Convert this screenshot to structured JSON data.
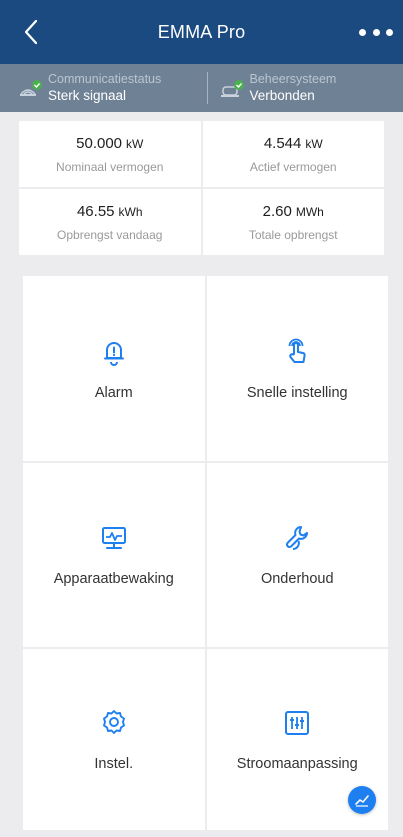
{
  "header": {
    "title": "EMMA Pro",
    "back_icon": "chevron-left-icon",
    "more_icon": "more-horizontal-icon"
  },
  "status": [
    {
      "label": "Communicatiestatus",
      "value": "Sterk signaal",
      "icon": "signal-check-icon"
    },
    {
      "label": "Beheersysteem",
      "value": "Verbonden",
      "icon": "cloud-check-icon"
    }
  ],
  "stats": [
    {
      "value": "50.000",
      "unit": "kW",
      "label": "Nominaal vermogen"
    },
    {
      "value": "4.544",
      "unit": "kW",
      "label": "Actief vermogen"
    },
    {
      "value": "46.55",
      "unit": "kWh",
      "label": "Opbrengst vandaag"
    },
    {
      "value": "2.60",
      "unit": "MWh",
      "label": "Totale opbrengst"
    }
  ],
  "menu": [
    {
      "label": "Alarm",
      "icon": "bell-alert-icon"
    },
    {
      "label": "Snelle instelling",
      "icon": "tap-hand-icon"
    },
    {
      "label": "Apparaatbewaking",
      "icon": "monitor-pulse-icon"
    },
    {
      "label": "Onderhoud",
      "icon": "wrench-icon"
    },
    {
      "label": "Instel.",
      "icon": "gear-icon"
    },
    {
      "label": "Stroomaanpassing",
      "icon": "sliders-icon"
    }
  ],
  "fab": {
    "icon": "trend-chart-icon"
  },
  "colors": {
    "header_bg": "#1a4a80",
    "status_bg": "#6f8195",
    "accent": "#1e7ff0",
    "status_ok": "#4caf50"
  }
}
